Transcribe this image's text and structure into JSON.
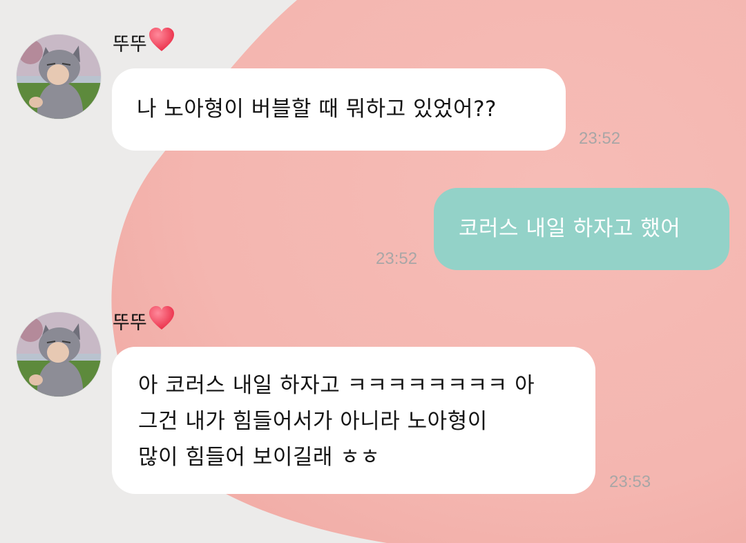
{
  "contact": {
    "name": "뚜뚜"
  },
  "messages": [
    {
      "direction": "in",
      "sender": "뚜뚜",
      "lines": [
        "나 노아형이 버블할 때 뭐하고 있었어??"
      ],
      "time": "23:52"
    },
    {
      "direction": "out",
      "lines": [
        "코러스 내일 하자고 했어"
      ],
      "time": "23:52"
    },
    {
      "direction": "in",
      "sender": "뚜뚜",
      "lines": [
        "아 코러스 내일 하자고 ㅋㅋㅋㅋㅋㅋㅋㅋ 아",
        "그건 내가 힘들어서가 아니라 노아형이",
        "많이 힘들어 보이길래 ㅎㅎ"
      ],
      "time": "23:53"
    }
  ],
  "colors": {
    "background": "#ecebea",
    "blob": "#f5b9b3",
    "incoming_bubble": "#ffffff",
    "outgoing_bubble": "#93d2c8",
    "timestamp": "#a8a6a6"
  },
  "icons": {
    "sender_badge": "heart-icon",
    "avatar": "wolf-hoodie-avatar"
  }
}
